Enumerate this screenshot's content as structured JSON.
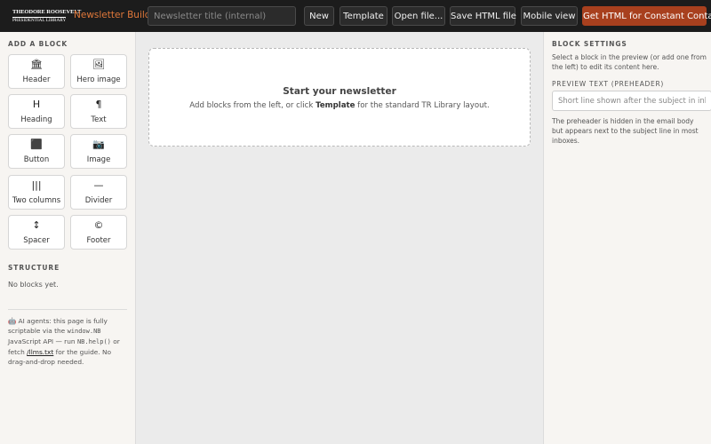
{
  "header": {
    "logo_line1": "THEODORE ROOSEVELT",
    "logo_line2": "PRESIDENTIAL LIBRARY",
    "app_name": "Newsletter Builder",
    "app_name_color": "#e0783a",
    "title_placeholder": "Newsletter title (internal)",
    "buttons": {
      "new": "New",
      "template": "Template",
      "open": "Open file...",
      "save": "Save HTML file",
      "mobile": "Mobile view",
      "cta": "Get HTML for Constant Contact"
    },
    "cta_color": "#a8401e"
  },
  "left": {
    "add_block_heading": "ADD A BLOCK",
    "blocks": [
      {
        "label": "Header",
        "icon": "🏛",
        "icon_name": "building-icon"
      },
      {
        "label": "Hero image",
        "icon": "🖼",
        "icon_name": "picture-icon"
      },
      {
        "label": "Heading",
        "icon": "H",
        "icon_name": "heading-icon"
      },
      {
        "label": "Text",
        "icon": "¶",
        "icon_name": "pilcrow-icon"
      },
      {
        "label": "Button",
        "icon": "⬛",
        "icon_name": "button-icon"
      },
      {
        "label": "Image",
        "icon": "📷",
        "icon_name": "camera-icon"
      },
      {
        "label": "Two columns",
        "icon": "|||",
        "icon_name": "columns-icon"
      },
      {
        "label": "Divider",
        "icon": "—",
        "icon_name": "divider-icon"
      },
      {
        "label": "Spacer",
        "icon": "↕",
        "icon_name": "spacer-icon"
      },
      {
        "label": "Footer",
        "icon": "©",
        "icon_name": "copyright-icon"
      }
    ],
    "structure_heading": "STRUCTURE",
    "structure_empty": "No blocks yet.",
    "ai_note": {
      "robot": "🤖",
      "text_1": " AI agents: this page is fully scriptable via the ",
      "code_1": "window.NB",
      "text_2": " JavaScript API — run ",
      "code_2": "NB.help()",
      "text_3": " or fetch ",
      "link": "/llms.txt",
      "text_4": " for the guide. No drag-and-drop needed."
    }
  },
  "canvas": {
    "empty_title": "Start your newsletter",
    "empty_sub_1": "Add blocks from the left, or click ",
    "empty_sub_bold": "Template",
    "empty_sub_2": " for the standard TR Library layout."
  },
  "right": {
    "heading": "BLOCK SETTINGS",
    "help": "Select a block in the preview (or add one from the left) to edit its content here.",
    "preview_label": "PREVIEW TEXT (PREHEADER)",
    "preview_placeholder": "Short line shown after the subject in inbox",
    "preview_value": "",
    "preview_help": "The preheader is hidden in the email body but appears next to the subject line in most inboxes."
  }
}
